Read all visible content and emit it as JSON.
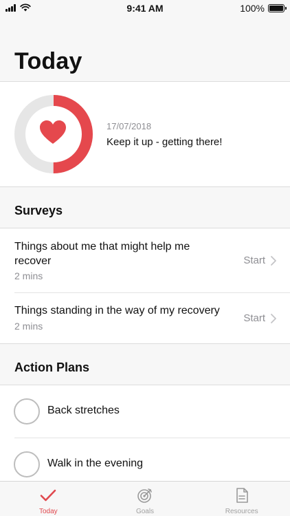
{
  "status_bar": {
    "time": "9:41 AM",
    "battery": "100%",
    "battery_level": 1.0
  },
  "header": {
    "title": "Today"
  },
  "progress": {
    "date": "17/07/2018",
    "message": "Keep it up - getting there!",
    "fraction": 0.5,
    "accent_color": "#e5484d",
    "track_color": "#e6e6e6"
  },
  "surveys": {
    "title": "Surveys",
    "items": [
      {
        "title": "Things about me that might help me recover",
        "duration": "2 mins",
        "action": "Start"
      },
      {
        "title": "Things standing in the way of my recovery",
        "duration": "2 mins",
        "action": "Start"
      }
    ]
  },
  "action_plans": {
    "title": "Action Plans",
    "items": [
      {
        "label": "Back stretches"
      },
      {
        "label": "Walk in the evening"
      }
    ]
  },
  "tabs": [
    {
      "label": "Today",
      "icon": "checkmark-icon",
      "active": true
    },
    {
      "label": "Goals",
      "icon": "target-icon",
      "active": false
    },
    {
      "label": "Resources",
      "icon": "document-icon",
      "active": false
    }
  ]
}
